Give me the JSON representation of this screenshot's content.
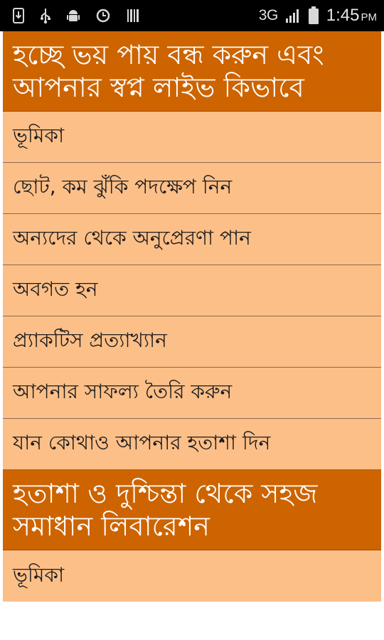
{
  "status_bar": {
    "network": "3G",
    "time": "1:45",
    "ampm": "PM",
    "icons": [
      "download-icon",
      "usb-icon",
      "android-icon",
      "sync-icon",
      "barcode-icon",
      "signal-icon",
      "battery-icon"
    ]
  },
  "sections": [
    {
      "title": "হচ্ছে ভয় পায় বন্ধ করুন এবং আপনার স্বপ্ন লাইভ কিভাবে",
      "items": [
        "ভূমিকা",
        "ছোট, কম ঝুঁকি পদক্ষেপ নিন",
        "অন্যদের থেকে অনুপ্রেরণা পান",
        "অবগত হন",
        "প্র্যাকটিস প্রত্যাখ্যান",
        "আপনার সাফল্য তৈরি করুন",
        "যান কোথাও আপনার হতাশা দিন"
      ]
    },
    {
      "title": "হতাশা ও দুশ্চিন্তা থেকে সহজ সমাধান লিবারেশন",
      "items": [
        "ভূমিকা"
      ]
    }
  ],
  "colors": {
    "header_bg": "#cd6400",
    "item_bg": "#fcbf88",
    "status_bg": "#000000"
  }
}
